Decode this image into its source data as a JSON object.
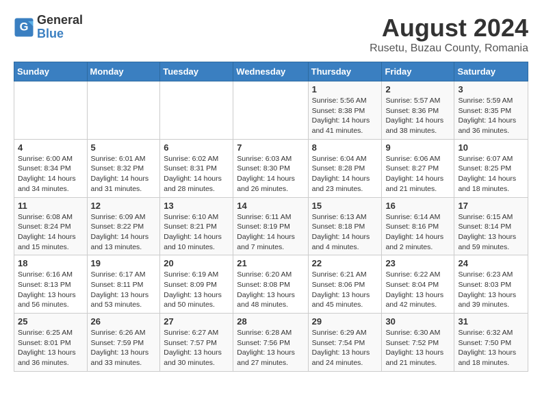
{
  "header": {
    "logo": {
      "general": "General",
      "blue": "Blue"
    },
    "title": "August 2024",
    "location": "Rusetu, Buzau County, Romania"
  },
  "calendar": {
    "weekdays": [
      "Sunday",
      "Monday",
      "Tuesday",
      "Wednesday",
      "Thursday",
      "Friday",
      "Saturday"
    ],
    "weeks": [
      [
        {
          "day": "",
          "info": ""
        },
        {
          "day": "",
          "info": ""
        },
        {
          "day": "",
          "info": ""
        },
        {
          "day": "",
          "info": ""
        },
        {
          "day": "1",
          "info": "Sunrise: 5:56 AM\nSunset: 8:38 PM\nDaylight: 14 hours and 41 minutes."
        },
        {
          "day": "2",
          "info": "Sunrise: 5:57 AM\nSunset: 8:36 PM\nDaylight: 14 hours and 38 minutes."
        },
        {
          "day": "3",
          "info": "Sunrise: 5:59 AM\nSunset: 8:35 PM\nDaylight: 14 hours and 36 minutes."
        }
      ],
      [
        {
          "day": "4",
          "info": "Sunrise: 6:00 AM\nSunset: 8:34 PM\nDaylight: 14 hours and 34 minutes."
        },
        {
          "day": "5",
          "info": "Sunrise: 6:01 AM\nSunset: 8:32 PM\nDaylight: 14 hours and 31 minutes."
        },
        {
          "day": "6",
          "info": "Sunrise: 6:02 AM\nSunset: 8:31 PM\nDaylight: 14 hours and 28 minutes."
        },
        {
          "day": "7",
          "info": "Sunrise: 6:03 AM\nSunset: 8:30 PM\nDaylight: 14 hours and 26 minutes."
        },
        {
          "day": "8",
          "info": "Sunrise: 6:04 AM\nSunset: 8:28 PM\nDaylight: 14 hours and 23 minutes."
        },
        {
          "day": "9",
          "info": "Sunrise: 6:06 AM\nSunset: 8:27 PM\nDaylight: 14 hours and 21 minutes."
        },
        {
          "day": "10",
          "info": "Sunrise: 6:07 AM\nSunset: 8:25 PM\nDaylight: 14 hours and 18 minutes."
        }
      ],
      [
        {
          "day": "11",
          "info": "Sunrise: 6:08 AM\nSunset: 8:24 PM\nDaylight: 14 hours and 15 minutes."
        },
        {
          "day": "12",
          "info": "Sunrise: 6:09 AM\nSunset: 8:22 PM\nDaylight: 14 hours and 13 minutes."
        },
        {
          "day": "13",
          "info": "Sunrise: 6:10 AM\nSunset: 8:21 PM\nDaylight: 14 hours and 10 minutes."
        },
        {
          "day": "14",
          "info": "Sunrise: 6:11 AM\nSunset: 8:19 PM\nDaylight: 14 hours and 7 minutes."
        },
        {
          "day": "15",
          "info": "Sunrise: 6:13 AM\nSunset: 8:18 PM\nDaylight: 14 hours and 4 minutes."
        },
        {
          "day": "16",
          "info": "Sunrise: 6:14 AM\nSunset: 8:16 PM\nDaylight: 14 hours and 2 minutes."
        },
        {
          "day": "17",
          "info": "Sunrise: 6:15 AM\nSunset: 8:14 PM\nDaylight: 13 hours and 59 minutes."
        }
      ],
      [
        {
          "day": "18",
          "info": "Sunrise: 6:16 AM\nSunset: 8:13 PM\nDaylight: 13 hours and 56 minutes."
        },
        {
          "day": "19",
          "info": "Sunrise: 6:17 AM\nSunset: 8:11 PM\nDaylight: 13 hours and 53 minutes."
        },
        {
          "day": "20",
          "info": "Sunrise: 6:19 AM\nSunset: 8:09 PM\nDaylight: 13 hours and 50 minutes."
        },
        {
          "day": "21",
          "info": "Sunrise: 6:20 AM\nSunset: 8:08 PM\nDaylight: 13 hours and 48 minutes."
        },
        {
          "day": "22",
          "info": "Sunrise: 6:21 AM\nSunset: 8:06 PM\nDaylight: 13 hours and 45 minutes."
        },
        {
          "day": "23",
          "info": "Sunrise: 6:22 AM\nSunset: 8:04 PM\nDaylight: 13 hours and 42 minutes."
        },
        {
          "day": "24",
          "info": "Sunrise: 6:23 AM\nSunset: 8:03 PM\nDaylight: 13 hours and 39 minutes."
        }
      ],
      [
        {
          "day": "25",
          "info": "Sunrise: 6:25 AM\nSunset: 8:01 PM\nDaylight: 13 hours and 36 minutes."
        },
        {
          "day": "26",
          "info": "Sunrise: 6:26 AM\nSunset: 7:59 PM\nDaylight: 13 hours and 33 minutes."
        },
        {
          "day": "27",
          "info": "Sunrise: 6:27 AM\nSunset: 7:57 PM\nDaylight: 13 hours and 30 minutes."
        },
        {
          "day": "28",
          "info": "Sunrise: 6:28 AM\nSunset: 7:56 PM\nDaylight: 13 hours and 27 minutes."
        },
        {
          "day": "29",
          "info": "Sunrise: 6:29 AM\nSunset: 7:54 PM\nDaylight: 13 hours and 24 minutes."
        },
        {
          "day": "30",
          "info": "Sunrise: 6:30 AM\nSunset: 7:52 PM\nDaylight: 13 hours and 21 minutes."
        },
        {
          "day": "31",
          "info": "Sunrise: 6:32 AM\nSunset: 7:50 PM\nDaylight: 13 hours and 18 minutes."
        }
      ]
    ]
  }
}
